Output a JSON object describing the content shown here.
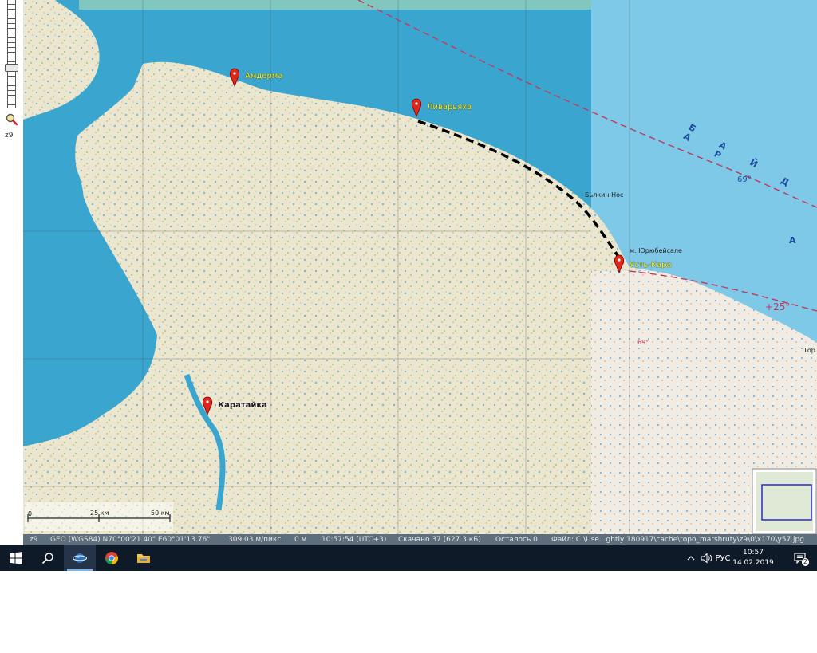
{
  "zoom_panel": {
    "zoom_level": "z9"
  },
  "map": {
    "places": [
      {
        "name": "Амдерма"
      },
      {
        "name": "Ливарьяха"
      },
      {
        "name": "Усть-Кара"
      },
      {
        "name": "Каратайка"
      }
    ],
    "labels": {
      "cape": "Бьлкин Нос",
      "settlement": "м. Юрюбейсале",
      "lat_69": "69°",
      "lat_69b": "69°",
      "sea_bay": "Б А Й Д А Р",
      "sea_a": "А",
      "temp": "+25°",
      "tor": "Тор"
    },
    "scale_bar": {
      "zero": "0",
      "mid": "25 км",
      "end": "50 км"
    },
    "colors": {
      "sea_overlay": "#3aa6cf",
      "sea_open": "#7ec8e8",
      "land": "#efe8d2",
      "route": "#000000",
      "marker": "#e0271c"
    }
  },
  "status_bar": {
    "zoom": "z9",
    "coords": "GEO (WGS84) N70°00'21.40\" E60°01'13.76\"",
    "resolution": "309.03 м/пикс.",
    "altitude": "0 м",
    "time": "10:57:54 (UTC+3)",
    "downloaded": "Скачано 37 (627.3 кБ)",
    "remaining": "Осталось 0",
    "file": "Файл: C:\\Use...ghtly 180917\\cache\\topo_marshruty\\z9\\0\\x170\\y57.jpg"
  },
  "taskbar": {
    "language": "РУС",
    "time": "10:57",
    "date": "14.02.2019",
    "notification_count": "2",
    "icons": [
      "windows-start-icon",
      "search-icon",
      "sasplanet-icon",
      "chrome-icon",
      "file-explorer-icon"
    ]
  }
}
